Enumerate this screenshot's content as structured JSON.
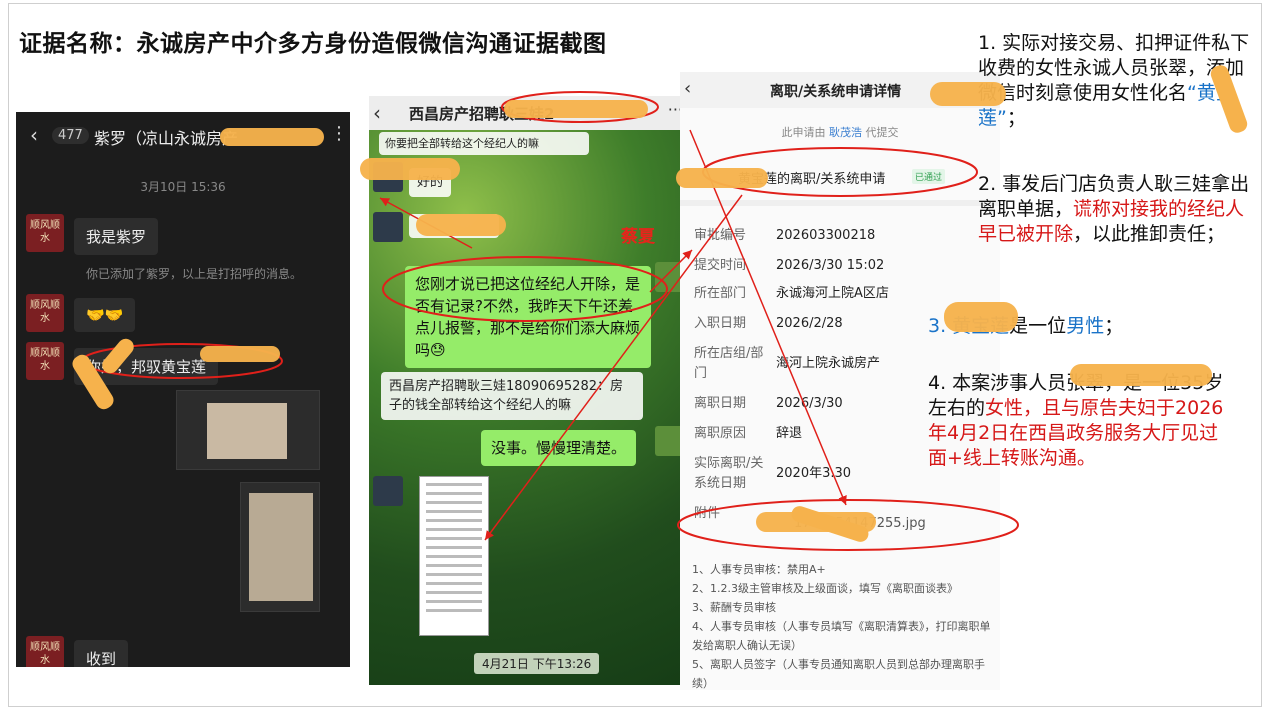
{
  "document": {
    "title": "证据名称：永诚房产中介多方身份造假微信沟通证据截图"
  },
  "panel1": {
    "unread_count": "477",
    "contact_name": "紫罗（凉山永诚房产",
    "timestamp": "3月10日 15:36",
    "avatar_text": "顺风顺水",
    "messages": [
      {
        "text": "我是紫罗"
      },
      {
        "text": "你已添加了紫罗，以上是打招呼的消息。",
        "type": "system"
      },
      {
        "text": "🤝🤝"
      },
      {
        "text": "你好，邦驭黄宝莲"
      },
      {
        "text": "收到"
      }
    ]
  },
  "panel2": {
    "chat_title": "西昌房产招聘耿三娃2",
    "partial_top": "你要把全部转给这个经纪人的嘛",
    "partial_reply": "好的",
    "messages": [
      {
        "text": "您刚才说已把这位经纪人开除，是否有记录?不然，我昨天下午还差点儿报警，那不是给你们添大麻烦吗😓",
        "type": "sent"
      },
      {
        "text": "西昌房产招聘耿三娃18090695282：房子的钱全部转给这个经纪人的嘛",
        "type": "quote"
      },
      {
        "text": "没事。慢慢理清楚。",
        "type": "sent"
      }
    ],
    "time_label": "4月21日 下午13:26",
    "red_label": "蔡夏"
  },
  "panel3": {
    "title": "离职/关系统申请详情",
    "on_behalf_prefix": "此申请由",
    "on_behalf_name": "耿茂浩",
    "on_behalf_suffix": "代提交",
    "applicant": "黄宝莲的离职/关系统申请",
    "status_badge": "已通过",
    "fields": [
      {
        "label": "审批编号",
        "value": "202603300218"
      },
      {
        "label": "提交时间",
        "value": "2026/3/30 15:02"
      },
      {
        "label": "所在部门",
        "value": "永诚海河上院A区店"
      },
      {
        "label": "入职日期",
        "value": "2026/2/28"
      },
      {
        "label": "所在店组/部门",
        "value": "海河上院永诚房产"
      },
      {
        "label": "离职日期",
        "value": "2026/3/30"
      },
      {
        "label": "离职原因",
        "value": "辞退"
      },
      {
        "label": "实际离职/关系统日期",
        "value": "2020年3.30"
      },
      {
        "label": "附件",
        "value": "1774854147255.jpg"
      }
    ],
    "notes": [
      "1、人事专员审核：禁用A+",
      "2、1.2.3级主管审核及上级面谈，填写《离职面谈表》",
      "3、薪酬专员审核",
      "4、人事专员审核（人事专员填写《离职清算表》，打印离职单发给离职人确认无误）",
      "5、离职人员签字（人事专员通知离职人员到总部办理离职手续）"
    ]
  },
  "right_notes": {
    "p1_a": "1. 实际对接交易、扣押证件私下收费的女性永诚人员张",
    "p1_b": "翠，添加微信时刻意使用女性化名",
    "p1_alias": "“黄宝莲”",
    "p1_end": "；",
    "p2_a": "2. 事发后门店负责人耿三娃拿出离职单据，",
    "p2_red": "谎称对接我的经纪人早已被开除",
    "p2_end": "，以此推卸责任；",
    "p3_a": "3. 黄宝莲",
    "p3_b": "是一位",
    "p3_blue": "男性",
    "p3_end": "；",
    "p4_a": "4. 本案涉事人员张翠，是一位35岁左右的",
    "p4_red1": "女性",
    "p4_red2": "，且与原告夫妇于2026年4月2日在西昌政务服务大厅见过面+线上转账沟通。"
  },
  "colors": {
    "redaction": "#f6b24c",
    "annotation_red": "#e8241b",
    "highlight_blue": "#1a73c8",
    "wechat_green": "#95ec69"
  }
}
